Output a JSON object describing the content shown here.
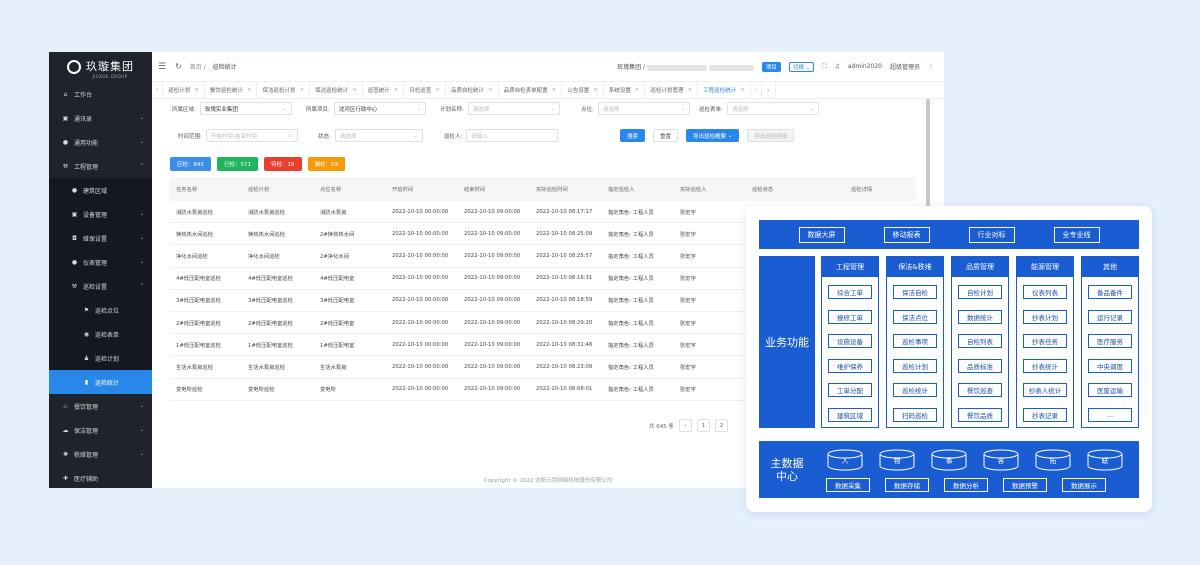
{
  "sidebar": {
    "logo": "玖璇集团",
    "logo_sub": "JIUXUE GROUP",
    "items": [
      {
        "label": "工作台",
        "icon": "home-icon"
      },
      {
        "label": "通讯录",
        "icon": "contacts-icon"
      },
      {
        "label": "通用功能",
        "icon": "circle-icon"
      },
      {
        "label": "工程管理",
        "icon": "wrench-icon"
      },
      {
        "label": "建筑区域",
        "icon": "building-icon"
      },
      {
        "label": "设备管理",
        "icon": "device-icon"
      },
      {
        "label": "维保设置",
        "icon": "maintenance-icon"
      },
      {
        "label": "仪表管理",
        "icon": "meter-icon"
      },
      {
        "label": "巡检设置",
        "icon": "wrench-icon"
      },
      {
        "label": "巡检点位",
        "icon": "flag-icon"
      },
      {
        "label": "巡检表单",
        "icon": "form-icon"
      },
      {
        "label": "巡检计划",
        "icon": "person-icon"
      },
      {
        "label": "巡检统计",
        "icon": "chart-icon"
      },
      {
        "label": "餐饮管理",
        "icon": "dining-icon"
      },
      {
        "label": "保洁管理",
        "icon": "cleaning-icon"
      },
      {
        "label": "秩维管理",
        "icon": "order-icon"
      },
      {
        "label": "医疗辅助",
        "icon": "medical-icon"
      }
    ]
  },
  "header": {
    "home": "首页",
    "current": "巡检统计",
    "company": "玫瑰集团 /",
    "project_badge": "项目",
    "switch_label": "切换",
    "user": "admin2020",
    "role": "超级管理员"
  },
  "tabs": [
    "巡检计划",
    "餐饮巡检统计",
    "保洁巡检计划",
    "保洁巡检统计",
    "巡查统计",
    "日检巡查",
    "品质自检统计",
    "品质自检表单配置",
    "公告设置",
    "系统设置",
    "巡检计划管理",
    "工程巡检统计"
  ],
  "filters": {
    "area_label": "所属区域:",
    "area_value": "玫瑰实业集团",
    "project_label": "所属项目:",
    "project_value": "沈河区行政中心",
    "plan_label": "计划名称:",
    "plan_ph": "请选择",
    "point_label": "点位:",
    "point_ph": "请选择",
    "form_label": "巡检表单:",
    "form_ph": "请选择",
    "time_label": "时间范围:",
    "time_ph": "开始时间-结束时间",
    "status_label": "状态:",
    "status_ph": "请选择",
    "person_label": "巡检人:",
    "person_ph": "请输入",
    "search_btn": "搜索",
    "reset_btn": "重置",
    "export_btn": "导出巡检概要",
    "export2_btn": "导出巡检明细"
  },
  "stats": [
    {
      "label": "应检：645",
      "color": "#3a8ee6"
    },
    {
      "label": "已检：571",
      "color": "#22b35e"
    },
    {
      "label": "待检：15",
      "color": "#e8402f"
    },
    {
      "label": "漏检：59",
      "color": "#f59a0b"
    }
  ],
  "table": {
    "headers": [
      "任务名称",
      "巡检计划",
      "点位名称",
      "开始时间",
      "结束时间",
      "实际巡检时间",
      "指定巡检人",
      "实际巡检人",
      "巡检状态",
      "巡检详情"
    ],
    "rows": [
      [
        "消防水泵房巡检",
        "消防水泵房巡检",
        "消防水泵房",
        "2022-10-10 00:00:00",
        "2022-10-10 09:00:00",
        "2022-10-10 08:17:17",
        "指定角色: 工程人员",
        "张宏宇",
        "",
        ""
      ],
      [
        "换热热水间巡检",
        "换热热水间巡检",
        "2#换热热水间",
        "2022-10-10 00:00:00",
        "2022-10-10 09:00:00",
        "2022-10-10 08:25:09",
        "指定角色: 工程人员",
        "张宏宇",
        "",
        ""
      ],
      [
        "净化水间巡检",
        "净化水间巡检",
        "2#净化水间",
        "2022-10-10 00:00:00",
        "2022-10-10 09:00:00",
        "2022-10-10 08:25:57",
        "指定角色: 工程人员",
        "张宏宇",
        "",
        ""
      ],
      [
        "4#低压配电室巡检",
        "4#低压配电室巡检",
        "4#低压配电室",
        "2022-10-10 00:00:00",
        "2022-10-10 09:00:00",
        "2022-10-10 08:16:31",
        "指定角色: 工程人员",
        "张宏宇",
        "",
        ""
      ],
      [
        "3#低压配电室巡检",
        "3#低压配电室巡检",
        "3#低压配电室",
        "2022-10-10 00:00:00",
        "2022-10-10 09:00:00",
        "2022-10-10 08:18:59",
        "指定角色: 工程人员",
        "张宏宇",
        "",
        ""
      ],
      [
        "2#低压配电室巡检",
        "2#低压配电室巡检",
        "2#低压配电室",
        "2022-10-10 00:00:00",
        "2022-10-10 09:00:00",
        "2022-10-10 08:29:20",
        "指定角色: 工程人员",
        "张宏宇",
        "",
        ""
      ],
      [
        "1#低压配电室巡检",
        "1#低压配电室巡检",
        "1#低压配电室",
        "2022-10-10 00:00:00",
        "2022-10-10 09:00:00",
        "2022-10-10 08:31:48",
        "指定角色: 工程人员",
        "张宏宇",
        "",
        ""
      ],
      [
        "生活水泵房巡检",
        "生活水泵房巡检",
        "生活水泵房",
        "2022-10-10 00:00:00",
        "2022-10-10 09:00:00",
        "2022-10-10 08:23:09",
        "指定角色: 工程人员",
        "张宏宇",
        "",
        ""
      ],
      [
        "变电所巡检",
        "变电所巡检",
        "变电所",
        "2022-10-10 00:00:00",
        "2022-10-10 09:00:00",
        "2022-10-10 08:08:01",
        "指定角色: 工程人员",
        "张宏宇",
        "",
        ""
      ]
    ]
  },
  "pager": {
    "total": "共 645 条",
    "pages": [
      "1",
      "2"
    ]
  },
  "copyright": "Copyright © 2022 沈阳示剑网络科技股份有限公司",
  "card": {
    "top_buttons": [
      "数据大屏",
      "移动报表",
      "行业对标",
      "全专业线"
    ],
    "business_label": "业务功能",
    "columns": [
      {
        "title": "工程管理",
        "items": [
          "综合工单",
          "报修工单",
          "设施设备",
          "维护保养",
          "工单分配",
          "建筑区域"
        ]
      },
      {
        "title": "保洁&秩维",
        "items": [
          "保洁自检",
          "保洁点位",
          "巡检事项",
          "巡检计划",
          "巡检统计",
          "扫码巡检"
        ]
      },
      {
        "title": "品质管理",
        "items": [
          "自检计划",
          "数据统计",
          "自检列表",
          "品质标准",
          "餐饮巡查",
          "餐饮品质"
        ]
      },
      {
        "title": "能源管理",
        "items": [
          "仪表列表",
          "抄表计划",
          "抄表任务",
          "抄表统计",
          "抄表人统计",
          "抄表记录"
        ]
      },
      {
        "title": "其他",
        "items": [
          "备品备件",
          "运行记录",
          "医疗服务",
          "中央调度",
          "医废运输",
          "..."
        ]
      }
    ],
    "master_label_1": "主数据",
    "master_label_2": "中心",
    "drums": [
      "人",
      "物",
      "事",
      "客",
      "拓",
      "联"
    ],
    "master_buttons": [
      "数据采集",
      "数据存储",
      "数据分析",
      "数据预警",
      "数据展示"
    ]
  }
}
